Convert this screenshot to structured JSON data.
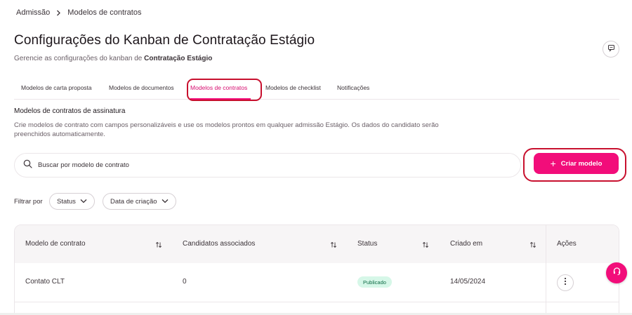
{
  "breadcrumb": {
    "items": [
      "Admissão",
      "Modelos de contratos"
    ]
  },
  "header": {
    "title": "Configurações do Kanban de Contratação Estágio",
    "subtitle_prefix": "Gerencie as configurações do kanban de ",
    "subtitle_bold": "Contratação Estágio"
  },
  "tabs": [
    {
      "label": "Modelos de carta proposta",
      "active": false
    },
    {
      "label": "Modelos de documentos",
      "active": false
    },
    {
      "label": "Modelos de contratos",
      "active": true
    },
    {
      "label": "Modelos de checklist",
      "active": false
    },
    {
      "label": "Notificações",
      "active": false
    }
  ],
  "section": {
    "title": "Modelos de contratos de assinatura",
    "description": "Crie modelos de contrato com campos personalizáveis e use os modelos prontos em qualquer admissão Estágio. Os dados do candidato serão preenchidos automaticamente."
  },
  "search": {
    "placeholder": "Buscar por modelo de contrato",
    "value": ""
  },
  "create_button": {
    "label": "Criar modelo"
  },
  "filters": {
    "label": "Filtrar por",
    "status": "Status",
    "created_date": "Data de criação"
  },
  "table": {
    "columns": [
      "Modelo de contrato",
      "Candidatos associados",
      "Status",
      "Criado em",
      "Ações"
    ],
    "rows": [
      {
        "model": "Contato CLT",
        "candidates": "0",
        "status": "Publicado",
        "created": "14/05/2024"
      }
    ]
  },
  "colors": {
    "accent": "#f20d7a",
    "annotation": "#c8102e",
    "badge_bg": "#d6f7e8",
    "badge_text": "#0e6b45"
  },
  "icons": {
    "breadcrumb_separator": "chevron-right-icon",
    "feedback": "chat-bubble-icon",
    "search": "search-icon",
    "add": "plus-icon",
    "dropdown": "chevron-down-icon",
    "sort": "sort-arrows-icon",
    "more": "more-vertical-icon",
    "support": "headset-icon"
  }
}
